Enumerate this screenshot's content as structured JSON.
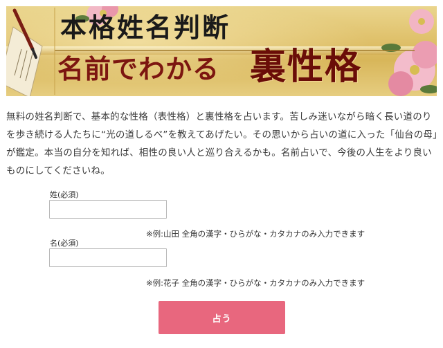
{
  "banner": {
    "title_line1": "本格姓名判断",
    "title_line2": "名前でわかる",
    "title_line3": "裏性格"
  },
  "intro": {
    "text": "無料の姓名判断で、基本的な性格（表性格）と裏性格を占います。苦しみ迷いながら暗く長い道のりを歩き続ける人たちに“光の道しるべ”を教えてあげたい。その思いから占いの道に入った「仙台の母」が鑑定。本当の自分を知れば、相性の良い人と巡り合えるかも。名前占いで、今後の人生をより良いものにしてくださいね。"
  },
  "form": {
    "surname": {
      "label": "姓(必須)",
      "value": "",
      "note": "※例:山田 全角の漢字・ひらがな・カタカナのみ入力できます"
    },
    "given_name": {
      "label": "名(必須)",
      "value": "",
      "note": "※例:花子 全角の漢字・ひらがな・カタカナのみ入力できます"
    },
    "submit_label": "占う"
  },
  "colors": {
    "button": "#e8677e",
    "banner_gold": "#e0c26d",
    "title_red": "#7c1610"
  }
}
